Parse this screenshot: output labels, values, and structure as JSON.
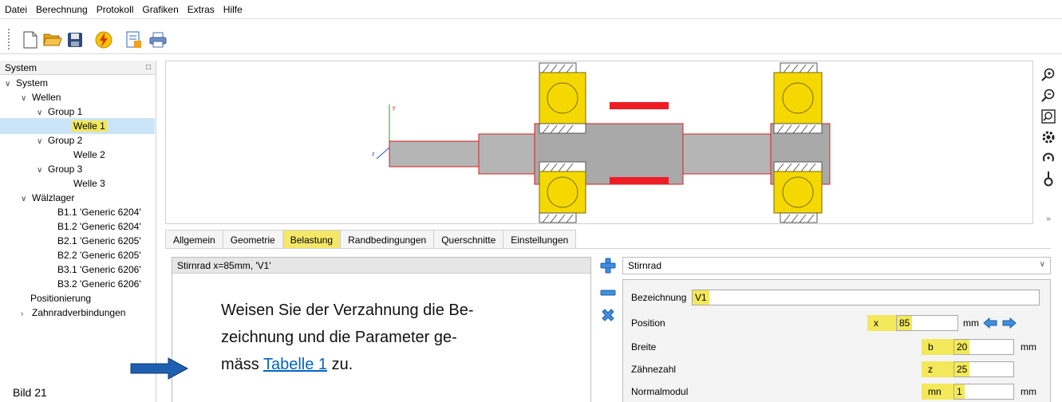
{
  "menu": [
    "Datei",
    "Berechnung",
    "Protokoll",
    "Grafiken",
    "Extras",
    "Hilfe"
  ],
  "toolbar_icons": [
    "new-document-icon",
    "open-folder-icon",
    "save-icon",
    "calculate-lightning-icon",
    "report-icon",
    "print-icon"
  ],
  "left_panel": {
    "title": "System",
    "tree": {
      "system": "System",
      "wellen": "Wellen",
      "group1": "Group 1",
      "welle1": "Welle 1",
      "group2": "Group 2",
      "welle2": "Welle 2",
      "group3": "Group 3",
      "welle3": "Welle 3",
      "waelzlager": "Wälzlager",
      "bearings": [
        "B1.1 'Generic 6204'",
        "B1.2 'Generic 6204'",
        "B2.1 'Generic 6205'",
        "B2.2 'Generic 6205'",
        "B3.1 'Generic 6206'",
        "B3.2 'Generic 6206'"
      ],
      "positionierung": "Positionierung",
      "zahnradverbindungen": "Zahnradverbindungen"
    }
  },
  "caption": "Bild 21",
  "right_tool_icons": [
    "zoom-in-icon",
    "zoom-out-icon",
    "zoom-fit-icon",
    "settings-gear-icon",
    "rotate-icon",
    "force-icon",
    "expand-more-icon"
  ],
  "tabs": [
    "Allgemein",
    "Geometrie",
    "Belastung",
    "Randbedingungen",
    "Querschnitte",
    "Einstellungen"
  ],
  "active_tab": "Belastung",
  "load_list": {
    "item": "Stirnrad  x=85mm, 'V1'"
  },
  "instruction": {
    "line1": "Weisen Sie der Verzahnung die Be-",
    "line2": "zeichnung und die Parameter ge-",
    "line3_prefix": "mäss ",
    "link": "Tabelle 1",
    "line3_suffix": " zu."
  },
  "load_type": "Stirnrad",
  "properties": {
    "bezeichnung": {
      "label": "Bezeichnung",
      "value": "V1"
    },
    "position": {
      "label": "Position",
      "symbol": "x",
      "value": "85",
      "unit": "mm"
    },
    "breite": {
      "label": "Breite",
      "symbol": "b",
      "value": "20",
      "unit": "mm"
    },
    "zaehnezahl": {
      "label": "Zähnezahl",
      "symbol": "z",
      "value": "25"
    },
    "normalmodul": {
      "label": "Normalmodul",
      "symbol": "mn",
      "value": "1",
      "unit": "mm"
    }
  },
  "colors": {
    "highlight_yellow": "#f3e85a",
    "bearing_yellow": "#f5d800",
    "gear_red": "#ee1c24",
    "shaft_gray": "#b0b0b0",
    "selection_blue": "#cce4f7",
    "link_blue": "#0563c1",
    "arrow_blue": "#1f5fb0"
  }
}
